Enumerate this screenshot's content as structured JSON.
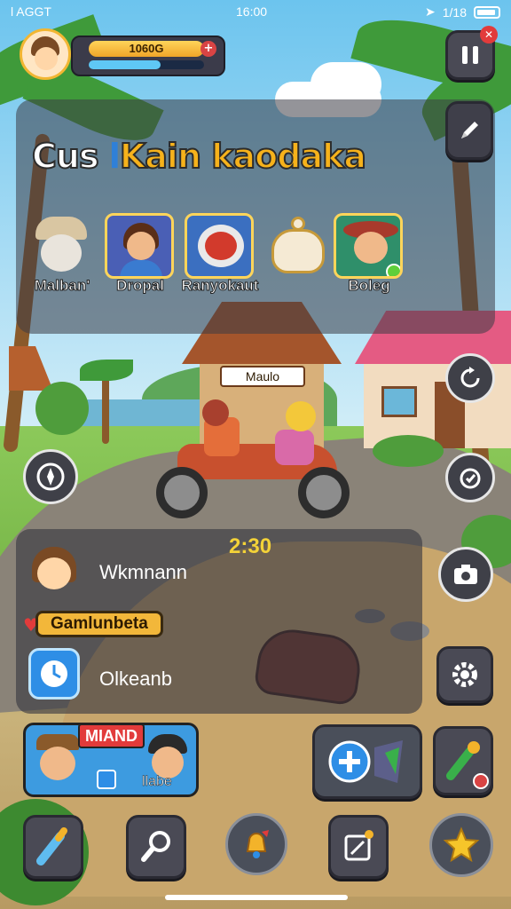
{
  "status_bar": {
    "carrier": "l AGGT",
    "time": "16:00",
    "network": "1/18"
  },
  "player": {
    "currency": "1060G",
    "energy_fraction": 0.62
  },
  "title": {
    "part1": "Cus",
    "part2": "Kain",
    "part3": "kaodaka"
  },
  "characters": [
    {
      "label": "Malban'",
      "icon": "chef-hat-icon"
    },
    {
      "label": "Dropal",
      "icon": "girl-portrait-icon"
    },
    {
      "label": "Ranyokaut",
      "icon": "food-plate-icon"
    },
    {
      "label": "",
      "icon": "teapot-icon"
    },
    {
      "label": "Boleg",
      "icon": "cowgirl-portrait-icon"
    }
  ],
  "shop_sign": "Maulo",
  "mission": {
    "score": "2:30",
    "name": "Wkmnann",
    "tag": "Gamlunbeta",
    "timer_label": "Olkeanb"
  },
  "team": {
    "badge": "MIAND",
    "label": "llabe"
  },
  "colors": {
    "accent_gold": "#f6b21b",
    "panel": "#3c3c46",
    "accent_red": "#e23b3b"
  }
}
